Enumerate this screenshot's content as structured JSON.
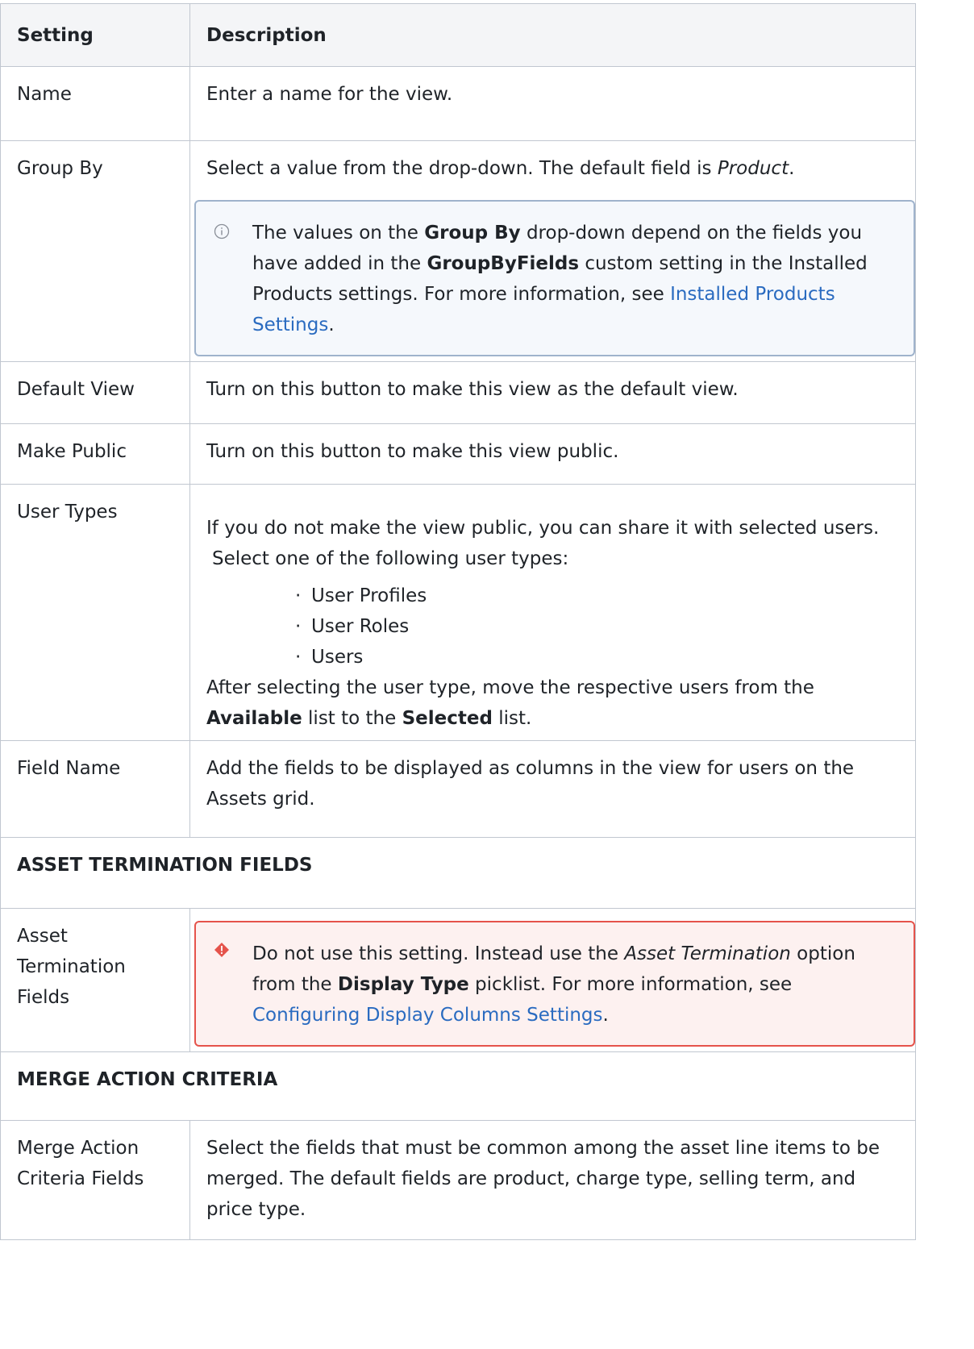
{
  "header": {
    "setting": "Setting",
    "description": "Description"
  },
  "rows": {
    "name": {
      "setting": "Name",
      "description": "Enter a name for the view."
    },
    "group_by": {
      "setting": "Group By",
      "desc_prefix": "Select a value from the drop-down. The default field is ",
      "desc_italic": "Product",
      "desc_suffix": ".",
      "note": {
        "t1": "The values on the ",
        "b1": "Group By",
        "t2": " drop-down depend on the fields you have added in the ",
        "b2": "GroupByFields",
        "t3": " custom setting in the Installed Products settings. For more information, see ",
        "link": "Installed Products Settings",
        "t4": "."
      }
    },
    "default_view": {
      "setting": "Default View",
      "description": "Turn on this button to make this view as the default view."
    },
    "make_public": {
      "setting": "Make Public",
      "description": "Turn on this button to make this view public."
    },
    "user_types": {
      "setting": "User Types",
      "intro": "If you do not make the view public, you can share it with selected users.",
      "intro2": "Select one of the following user types:",
      "items": [
        "User Profiles",
        "User Roles",
        "Users"
      ],
      "after_t1": "After selecting the user type, move the respective users from the ",
      "after_b1": "Available",
      "after_t2": " list to the ",
      "after_b2": "Selected",
      "after_t3": " list."
    },
    "field_name": {
      "setting": "Field Name",
      "description": "Add the fields to be displayed as columns in the view for users on the Assets grid."
    },
    "asset_termination_section": "ASSET TERMINATION FIELDS",
    "asset_termination": {
      "setting": "Asset Termination Fields",
      "warn": {
        "t1": "Do not use this setting. Instead use the ",
        "i1": "Asset Termination",
        "t2": " option from the ",
        "b1": "Display Type",
        "t3": " picklist. For more information, see ",
        "link": "Configuring Display Columns Settings",
        "t4": "."
      }
    },
    "merge_section": "MERGE ACTION CRITERIA",
    "merge": {
      "setting": "Merge Action Criteria Fields",
      "description": "Select the fields that must be common among the asset line items to be merged. The default fields are product, charge type, selling term, and price type."
    }
  },
  "icons": {
    "info": "info-circle-icon",
    "warning": "warning-diamond-icon"
  },
  "colors": {
    "link": "#2a6bc0",
    "border": "#c1c7d0",
    "danger": "#e5534b",
    "info_border": "#9fb3cc"
  }
}
